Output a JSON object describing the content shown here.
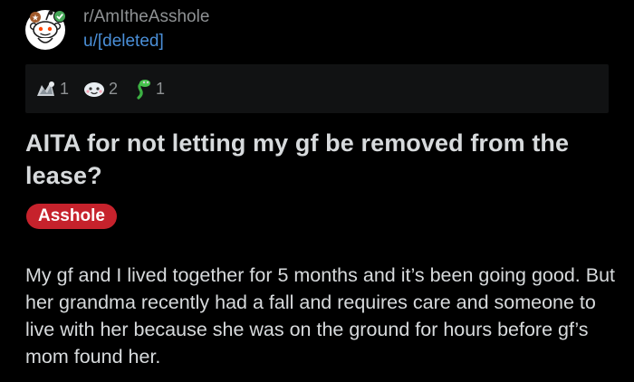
{
  "post": {
    "subreddit": "r/AmItheAsshole",
    "author": "u/[deleted]",
    "title": "AITA for not letting my gf be removed from the lease?",
    "flair": "Asshole",
    "body": "My gf and I lived together for 5 months and it’s been going good. But her grandma recently had a fall and requires care and someone to live with her because she was on the ground for hours before gf’s mom found her."
  },
  "awards": [
    {
      "icon": "silver-award-icon",
      "count": "1"
    },
    {
      "icon": "wholesome-award-icon",
      "count": "2"
    },
    {
      "icon": "green-snake-award-icon",
      "count": "1"
    }
  ],
  "colors": {
    "background": "#000000",
    "text": "#d7dadc",
    "muted": "#8f9294",
    "link": "#4a8fd8",
    "flair": "#c6222c",
    "award_bar": "#111213"
  }
}
